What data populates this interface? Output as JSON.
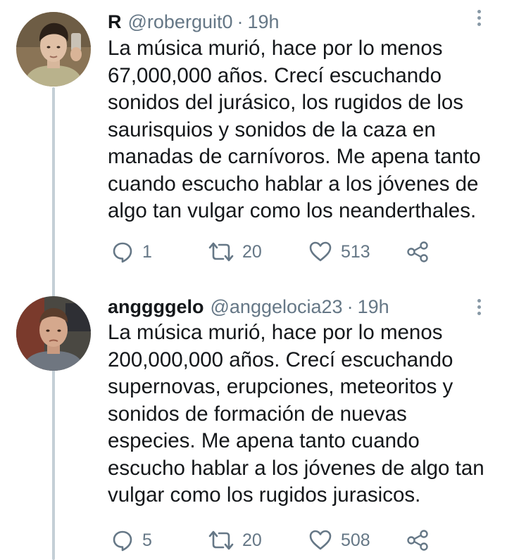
{
  "colors": {
    "text": "#14171a",
    "secondary": "#657786",
    "thread_line": "#c4cfd6"
  },
  "tweets": [
    {
      "display_name": "R",
      "handle": "@roberguit0",
      "separator": "·",
      "time": "19h",
      "text": "La música murió, hace por lo menos\n67,000,000 años. Crecí escuchando\nsonidos del jurásico, los rugidos de los\nsaurisquios y sonidos de la caza en\nmanadas de carnívoros. Me apena tanto\ncuando escucho hablar a los jóvenes de\nalgo tan vulgar como los neanderthales.",
      "replies": "1",
      "retweets": "20",
      "likes": "513",
      "icons": [
        "reply-icon",
        "retweet-icon",
        "like-icon",
        "share-icon",
        "more-icon"
      ]
    },
    {
      "display_name": "anggggelo",
      "handle": "@anggelocia23",
      "separator": "·",
      "time": "19h",
      "text": "La música murió, hace por lo menos\n200,000,000 años. Crecí escuchando\nsupernovas, erupciones, meteoritos y\nsonidos de formación de nuevas\nespecies. Me apena tanto cuando\nescucho hablar a los jóvenes de algo tan\nvulgar como los rugidos jurasicos.",
      "replies": "5",
      "retweets": "20",
      "likes": "508",
      "icons": [
        "reply-icon",
        "retweet-icon",
        "like-icon",
        "share-icon",
        "more-icon"
      ]
    }
  ]
}
